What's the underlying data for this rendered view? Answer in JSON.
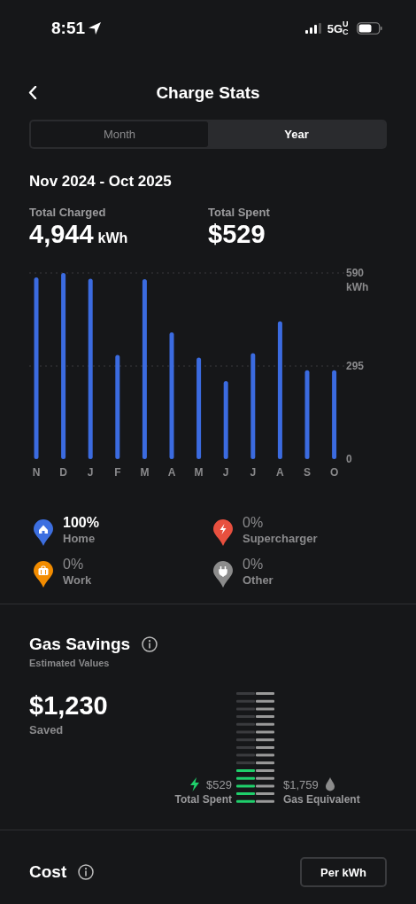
{
  "status_bar": {
    "time": "8:51",
    "network": "5G",
    "network_badge": "UC"
  },
  "header": {
    "title": "Charge Stats"
  },
  "tabs": [
    {
      "label": "Month",
      "selected": false
    },
    {
      "label": "Year",
      "selected": true
    }
  ],
  "period": "Nov 2024 - Oct 2025",
  "totals": [
    {
      "label": "Total Charged",
      "value": "4,944",
      "unit": "kWh"
    },
    {
      "label": "Total Spent",
      "value": "$529"
    }
  ],
  "chart_data": {
    "type": "bar",
    "categories": [
      "N",
      "D",
      "J",
      "F",
      "M",
      "A",
      "M",
      "J",
      "J",
      "A",
      "S",
      "O"
    ],
    "series": [
      {
        "color": "#3b6be0",
        "values": [
          576,
          590,
          572,
          330,
          570,
          402,
          322,
          247,
          336,
          437,
          282,
          282
        ]
      }
    ],
    "ylim": [
      0,
      590
    ],
    "ylabel": "kWh",
    "yticks": [
      0,
      295,
      590
    ]
  },
  "legend": [
    {
      "kind": "home",
      "percent": "100%",
      "label": "Home",
      "color": "#3d6fe0",
      "highlighted": true
    },
    {
      "kind": "supercharger",
      "percent": "0%",
      "label": "Supercharger",
      "color": "#e8503f",
      "highlighted": false
    },
    {
      "kind": "work",
      "percent": "0%",
      "label": "Work",
      "color": "#f28c00",
      "highlighted": false
    },
    {
      "kind": "other",
      "percent": "0%",
      "label": "Other",
      "color": "#8c8c8c",
      "highlighted": false
    }
  ],
  "gas_savings": {
    "title": "Gas Savings",
    "subtitle": "Estimated Values",
    "amount": "$1,230",
    "amount_label": "Saved",
    "spent_value": "$529",
    "spent_label": "Total Spent",
    "gas_value": "$1,759",
    "gas_label": "Gas Equivalent"
  },
  "cost": {
    "title": "Cost",
    "button": "Per kWh"
  }
}
